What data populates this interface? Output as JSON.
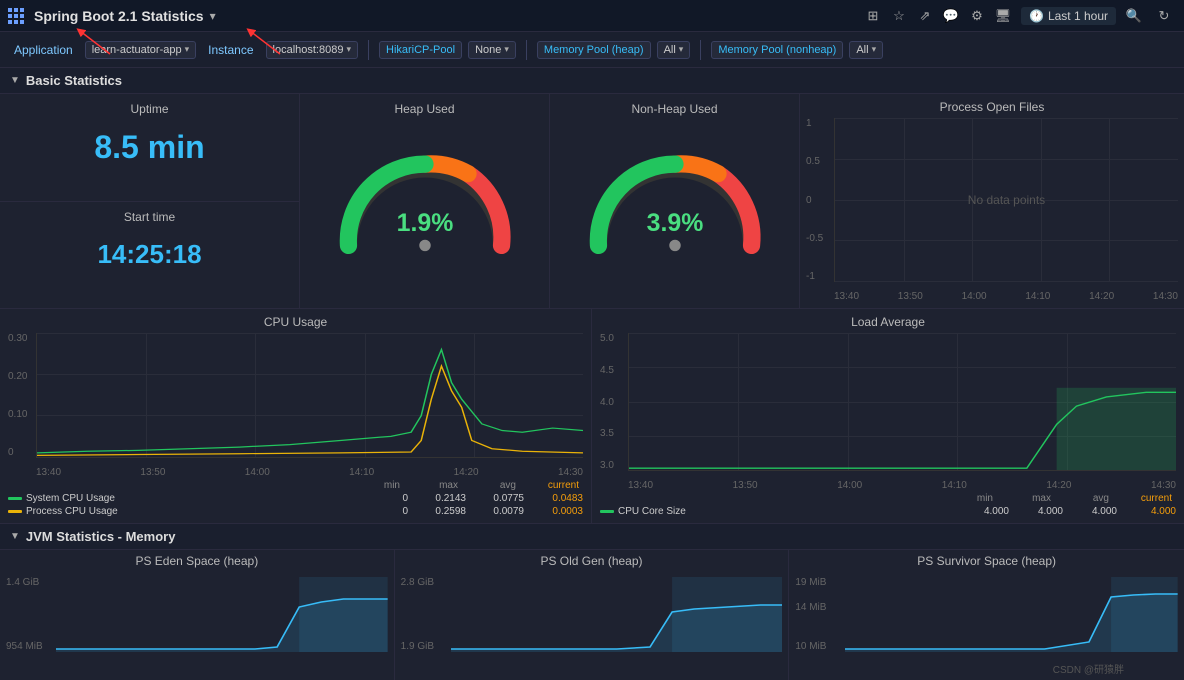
{
  "topbar": {
    "title": "Spring Boot 2.1 Statistics",
    "dropdown_arrow": "▾",
    "time_icon": "🕐",
    "time_label": "Last 1 hour",
    "icons": [
      "grid",
      "star",
      "share",
      "comment",
      "gear",
      "monitor",
      "search",
      "refresh"
    ]
  },
  "filterbar": {
    "app_label": "Application",
    "app_value": "learn-actuator-app",
    "instance_label": "Instance",
    "instance_value": "localhost:8089",
    "hikari_label": "HikariCP-Pool",
    "hikari_none": "None",
    "heap_label": "Memory Pool (heap)",
    "heap_all": "All",
    "nonheap_label": "Memory Pool (nonheap)",
    "nonheap_all": "All"
  },
  "basic_stats": {
    "title": "Basic Statistics",
    "uptime_label": "Uptime",
    "uptime_value": "8.5 min",
    "starttime_label": "Start time",
    "starttime_value": "14:25:18",
    "heap_label": "Heap Used",
    "heap_value": "1.9%",
    "nonheap_label": "Non-Heap Used",
    "nonheap_value": "3.9%",
    "openfiles_label": "Process Open Files",
    "no_data": "No data points",
    "x_labels_files": [
      "13:40",
      "13:50",
      "14:00",
      "14:10",
      "14:20",
      "14:30"
    ],
    "y_labels_files": [
      "1",
      "0.5",
      "0",
      "-0.5",
      "-1"
    ]
  },
  "cpu": {
    "title": "CPU Usage",
    "y_labels": [
      "0.30",
      "0.20",
      "0.10",
      "0"
    ],
    "x_labels": [
      "13:40",
      "13:50",
      "14:00",
      "14:10",
      "14:20",
      "14:30"
    ],
    "legend": [
      {
        "name": "System CPU Usage",
        "color": "#22c55e",
        "min": "0",
        "max": "0.2143",
        "avg": "0.0775",
        "current": "0.0483"
      },
      {
        "name": "Process CPU Usage",
        "color": "#eab308",
        "min": "0",
        "max": "0.2598",
        "avg": "0.0079",
        "current": "0.0003"
      }
    ],
    "col_headers": [
      "min",
      "max",
      "avg",
      "current"
    ]
  },
  "load": {
    "title": "Load Average",
    "y_labels": [
      "5.0",
      "4.5",
      "4.0",
      "3.5",
      "3.0"
    ],
    "x_labels": [
      "13:40",
      "13:50",
      "14:00",
      "14:10",
      "14:20",
      "14:30"
    ],
    "legend": [
      {
        "name": "CPU Core Size",
        "color": "#22c55e",
        "min": "4.000",
        "max": "4.000",
        "avg": "4.000",
        "current": "4.000"
      }
    ],
    "col_headers": [
      "min",
      "max",
      "avg",
      "current"
    ]
  },
  "jvm": {
    "title": "JVM Statistics - Memory",
    "panels": [
      {
        "title": "PS Eden Space (heap)",
        "y_top": "1.4 GiB",
        "y_bottom": "954 MiB"
      },
      {
        "title": "PS Old Gen (heap)",
        "y_top": "2.8 GiB",
        "y_bottom": "1.9 GiB"
      },
      {
        "title": "PS Survivor Space (heap)",
        "y_top": "19 MiB",
        "y_bottom": "10 MiB",
        "y_mid": "14 MiB"
      }
    ]
  },
  "watermark": "CSDN @研猿胖"
}
